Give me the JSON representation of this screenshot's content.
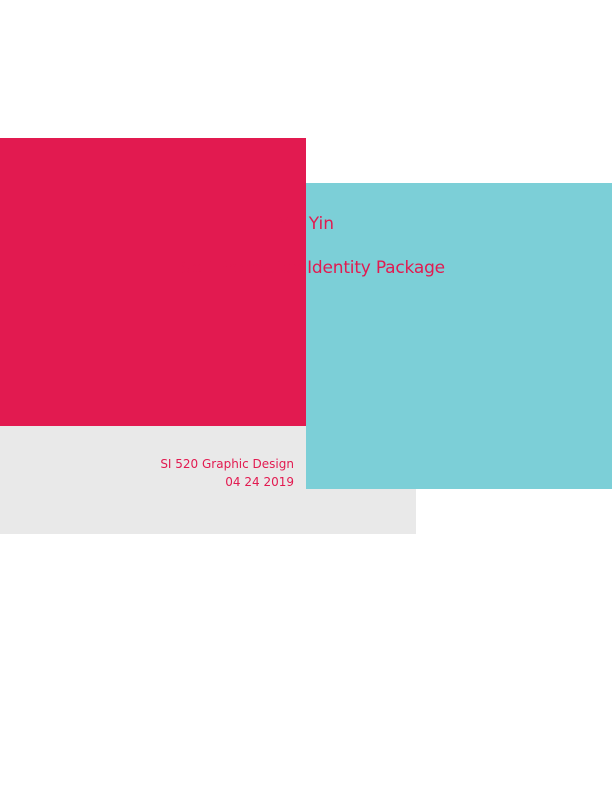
{
  "cover": {
    "name": "Yin Yin",
    "project_title": "Self-Promotion Identity Package",
    "course": "SI 520 Graphic Design",
    "date": "04 24 2019"
  },
  "colors": {
    "accent_red": "#e21a50",
    "accent_teal": "#7ccfd7",
    "panel_gray": "#e9e9e9",
    "text": "#e21a50"
  }
}
